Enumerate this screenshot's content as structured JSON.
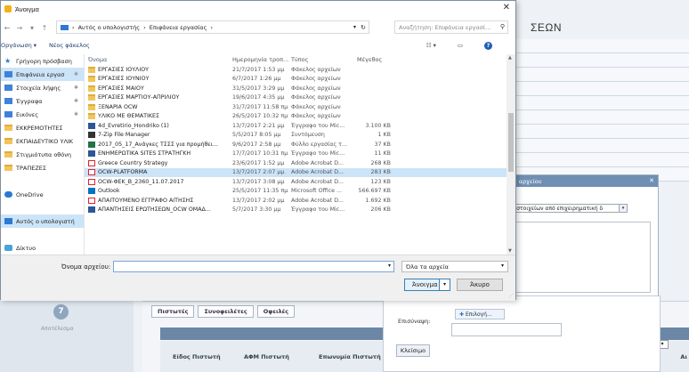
{
  "background": {
    "title_fragment": "ΣΕΩΝ",
    "step_number": "7",
    "step_label": "Αποτέλεσμα",
    "tabs": [
      "Πιστωτές",
      "Συνοφειλέτες",
      "Οφειλές"
    ],
    "table_headers": [
      "Είδος Πιστωτή",
      "ΑΦΜ Πιστωτή",
      "Επωνυμία Πιστωτή"
    ],
    "header_cut_label": "Αι"
  },
  "secondary_dialog": {
    "title": "ς αρχείου",
    "select_value": "ν στοιχείων από επιχειρηματική δ"
  },
  "attach_form": {
    "label": "Επισύναψη:",
    "browse_label": "Επιλογή...",
    "close_label": "Κλείσιμο"
  },
  "dialog": {
    "title": "Άνοιγμα",
    "breadcrumb": [
      "Αυτός ο υπολογιστής",
      "Επιφάνεια εργασίας"
    ],
    "search_placeholder": "Αναζήτηση: Επιφάνεια εργασί...",
    "organize_label": "Οργάνωση ▾",
    "new_folder_label": "Νέος φάκελος",
    "columns": {
      "name": "Όνομα",
      "date": "Ημερομηνία τροπ...",
      "type": "Τύπος",
      "size": "Μέγεθος"
    },
    "sidebar": [
      {
        "label": "Γρήγορη πρόσβαση",
        "icon": "star-icon",
        "pin": ""
      },
      {
        "label": "Επιφάνεια εργασ",
        "icon": "desktop-icon",
        "pin": "✱",
        "selected": true
      },
      {
        "label": "Στοιχεία λήψης",
        "icon": "downloads-icon",
        "pin": "✱"
      },
      {
        "label": "Έγγραφα",
        "icon": "documents-icon",
        "pin": "✱"
      },
      {
        "label": "Εικόνες",
        "icon": "pictures-icon",
        "pin": "✱"
      },
      {
        "label": "ΕΚΚΡΕΜΟΤΗΤΕΣ",
        "icon": "folder-icon",
        "pin": ""
      },
      {
        "label": "ΕΚΠΑΙΔΕΥΤΙΚΟ ΥΛΙΚ",
        "icon": "folder-icon",
        "pin": ""
      },
      {
        "label": "Στιγμιότυπα οθόνη",
        "icon": "folder-icon",
        "pin": ""
      },
      {
        "label": "ΤΡΑΠΕΖΕΣ",
        "icon": "folder-icon",
        "pin": ""
      },
      {
        "label": "",
        "icon": "",
        "pin": ""
      },
      {
        "label": "OneDrive",
        "icon": "onedrive-icon",
        "pin": ""
      },
      {
        "label": "",
        "icon": "",
        "pin": ""
      },
      {
        "label": "Αυτός ο υπολογιστή",
        "icon": "this-pc-icon",
        "pin": "",
        "selected": true
      },
      {
        "label": "",
        "icon": "",
        "pin": ""
      },
      {
        "label": "Δίκτυο",
        "icon": "network-icon",
        "pin": ""
      }
    ],
    "files": [
      {
        "name": "ΕΡΓΑΣΙΕΣ ΙΟΥΛΙΟΥ",
        "date": "21/7/2017 1:53 μμ",
        "type": "Φάκελος αρχείων",
        "size": "",
        "icon": "folder"
      },
      {
        "name": "ΕΡΓΑΣΙΕΣ ΙΟΥΝΙΟΥ",
        "date": "6/7/2017 1:26 μμ",
        "type": "Φάκελος αρχείων",
        "size": "",
        "icon": "folder"
      },
      {
        "name": "ΕΡΓΑΣΙΕΣ ΜΑΙΟΥ",
        "date": "31/5/2017 3:29 μμ",
        "type": "Φάκελος αρχείων",
        "size": "",
        "icon": "folder"
      },
      {
        "name": "ΕΡΓΑΣΙΕΣ ΜΑΡΤΙΟΥ-ΑΠΡΙΛΙΟΥ",
        "date": "19/6/2017 4:35 μμ",
        "type": "Φάκελος αρχείων",
        "size": "",
        "icon": "folder"
      },
      {
        "name": "ΞΕΝΑΡΙΑ OCW",
        "date": "31/7/2017 11:58 πμ",
        "type": "Φάκελος αρχείων",
        "size": "",
        "icon": "folder"
      },
      {
        "name": "ΥΛΙΚΟ ΜΕ ΘΕΜΑΤΙΚΕΣ",
        "date": "26/5/2017 10:32 πμ",
        "type": "Φάκελος αρχείων",
        "size": "",
        "icon": "folder"
      },
      {
        "name": "4d_Evretirio_Hondriko (1)",
        "date": "13/7/2017 2:21 μμ",
        "type": "Έγγραφο του Mic...",
        "size": "3.100 KB",
        "icon": "word"
      },
      {
        "name": "7-Zip File Manager",
        "date": "5/5/2017 8:05 μμ",
        "type": "Συντόμευση",
        "size": "1 KB",
        "icon": "zip"
      },
      {
        "name": "2017_05_17_Ανάγκες ΤΣΣΣ για προμήθει...",
        "date": "9/6/2017 2:58 μμ",
        "type": "Φύλλο εργασίας τ...",
        "size": "37 KB",
        "icon": "excel"
      },
      {
        "name": "ΕΝΗΜΕΡΩΤΙΚΑ SITES ΣΤΡΑΤΗΓΚΗ",
        "date": "17/7/2017 10:31 πμ",
        "type": "Έγγραφο του Mic...",
        "size": "11 KB",
        "icon": "word"
      },
      {
        "name": "Greece Country Strategy",
        "date": "23/6/2017 1:52 μμ",
        "type": "Adobe Acrobat D...",
        "size": "268 KB",
        "icon": "pdf"
      },
      {
        "name": "OCW-PLATFORMA",
        "date": "13/7/2017 2:07 μμ",
        "type": "Adobe Acrobat D...",
        "size": "283 KB",
        "icon": "pdf",
        "highlight": true
      },
      {
        "name": "OCW-ΦΕΚ_Β_2360_11.07.2017",
        "date": "13/7/2017 3:08 μμ",
        "type": "Adobe Acrobat D...",
        "size": "123 KB",
        "icon": "pdf"
      },
      {
        "name": "Outlook",
        "date": "25/5/2017 11:35 πμ",
        "type": "Microsoft Office ...",
        "size": "566.697 KB",
        "icon": "outlook"
      },
      {
        "name": "ΑΠΑΙΤΟΥΜΕΝΟ ΕΓΓΡΑΦΟ ΑΙΤΗΣΗΣ",
        "date": "13/7/2017 2:02 μμ",
        "type": "Adobe Acrobat D...",
        "size": "1.692 KB",
        "icon": "pdf"
      },
      {
        "name": "ΑΠΑΝΤΗΣΕΙΣ ΕΡΩΤΗΣΕΩΝ_OCW ΟΜΑΔ...",
        "date": "5/7/2017 3:30 μμ",
        "type": "Έγγραφο του Mic...",
        "size": "206 KB",
        "icon": "word"
      }
    ],
    "filename_label": "Όνομα αρχείου:",
    "filename_value": "",
    "filetype_value": "Όλα τα αρχεία",
    "open_label": "Άνοιγμα",
    "cancel_label": "Άκυρο"
  }
}
